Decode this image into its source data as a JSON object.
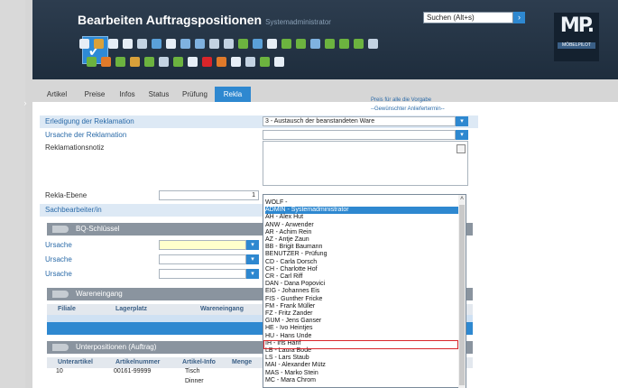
{
  "header": {
    "title": "Bearbeiten Auftragspositionen",
    "user": "Systemadministrator",
    "search_placeholder": "Suchen (Alt+s)",
    "logo_text": "MP.",
    "logo_sub": "MÖBELPILOT",
    "accent": "#2e88d0",
    "background": "#1e2d3d"
  },
  "tabs": [
    {
      "label": "Artikel"
    },
    {
      "label": "Preise"
    },
    {
      "label": "Infos"
    },
    {
      "label": "Status"
    },
    {
      "label": "Prüfung"
    },
    {
      "label": "Rekla",
      "active": true
    }
  ],
  "form": {
    "hint_top": "Preis für alle die Vorgabe",
    "hint_bottom": "--Gewünschter Anliefertermin--",
    "erledigung_label": "Erledigung der Reklamation",
    "erledigung_value": "3 - Austausch der beanstandeten Ware",
    "ursache_label": "Ursache der Reklamation",
    "ursache_value": "",
    "notiz_label": "Reklamationsnotiz",
    "ebene_label": "Rekla-Ebene",
    "ebene_value": "1",
    "sachbearbeiter_label": "Sachbearbeiter/in"
  },
  "bq": {
    "title": "BQ-Schlüssel",
    "rows": [
      {
        "label": "Ursache",
        "value": ""
      },
      {
        "label": "Ursache",
        "value": ""
      },
      {
        "label": "Ursache",
        "value": ""
      }
    ]
  },
  "wareneingang": {
    "title": "Wareneingang",
    "columns": [
      "Filiale",
      "Lagerplatz",
      "Wareneingang"
    ]
  },
  "unterpositionen": {
    "title": "Unterpositionen (Auftrag)",
    "columns": [
      "Unterartikel",
      "Artikelnummer",
      "Artikel-Info",
      "Menge"
    ],
    "rows": [
      {
        "unterartikel": "10",
        "artikelnummer": "00161-99999",
        "info": "Tisch",
        "menge": ""
      },
      {
        "unterartikel": "",
        "artikelnummer": "",
        "info": "Dinner",
        "menge": ""
      }
    ]
  },
  "dropdown": {
    "items": [
      "WOLF -",
      "ADMIN - Systemadministrator",
      "AH - Alex Hut",
      "ANW - Anwender",
      "AR - Achim Rein",
      "AZ - Antje Zaun",
      "BB - Brigit Baumann",
      "BENUTZER - Prüfung",
      "CD - Carla Dorsch",
      "CH - Charlotte Hof",
      "CR - Carl Riff",
      "DAN - Dana Popovici",
      "EIG - Johannes Eis",
      "FIS - Gunther Fricke",
      "FM - Frank Müller",
      "FZ - Fritz Zander",
      "GUM - Jens Ganser",
      "HE - Ivo Heintjes",
      "HU - Hans Unde",
      "IH - Iris Hanf",
      "LB - Laura Bode",
      "LS - Lars Staub",
      "MAI - Alexander Mütz",
      "MAS - Marko Stein",
      "MC - Mara Chrom"
    ],
    "selected": "ADMIN - Systemadministrator",
    "highlighted": "IH - Iris Hanf",
    "highlight_color": "#d9252a"
  }
}
